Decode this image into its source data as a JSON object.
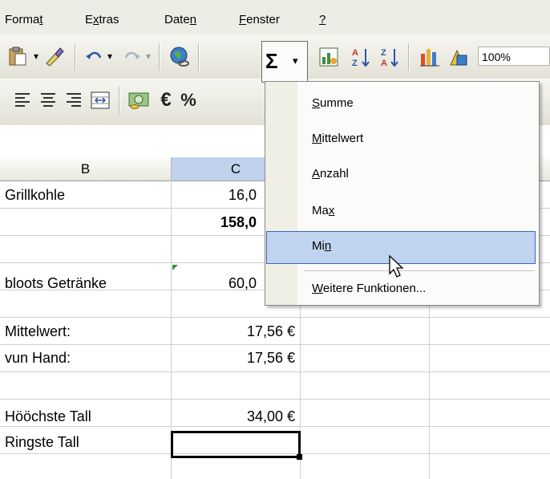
{
  "menubar": {
    "items": [
      {
        "pre": "Forma",
        "u": "t",
        "post": ""
      },
      {
        "pre": "E",
        "u": "x",
        "post": "tras"
      },
      {
        "pre": "Date",
        "u": "n",
        "post": ""
      },
      {
        "pre": "",
        "u": "F",
        "post": "enster"
      },
      {
        "pre": "",
        "u": "?",
        "post": ""
      }
    ]
  },
  "toolbar1": {
    "zoom": "100%",
    "icons": [
      "paste-icon",
      "format-painter-icon",
      "undo-icon",
      "redo-icon",
      "hyperlink-icon",
      "autosum-icon",
      "chart-wizard-icon",
      "sort-ascending-icon",
      "sort-descending-icon",
      "bar-chart-icon",
      "drawing-icon"
    ]
  },
  "toolbar2": {
    "icons": [
      "align-left-icon",
      "align-center-icon",
      "align-right-icon",
      "merge-center-icon",
      "currency-icon",
      "euro-icon"
    ]
  },
  "columns": [
    "B",
    "C"
  ],
  "rows": [
    {
      "b": "Grillkohle",
      "c": "16,0",
      "bold": false
    },
    {
      "b": "",
      "c": "158,0",
      "bold": true
    },
    {
      "b": "",
      "c": "",
      "bold": false
    },
    {
      "b": "bloots Getränke",
      "c": "60,0",
      "bold": false
    },
    {
      "b": "",
      "c": "",
      "bold": false
    },
    {
      "b": "Mittelwert:",
      "c": "17,56 €",
      "bold": false
    },
    {
      "b": "vun Hand:",
      "c": "17,56 €",
      "bold": false
    },
    {
      "b": "",
      "c": "",
      "bold": false
    },
    {
      "b": "Hööchste Tall",
      "c": "34,00 €",
      "bold": false
    },
    {
      "b": "Ringste Tall",
      "c": "",
      "bold": false
    }
  ],
  "dropdown": {
    "items": [
      {
        "pre": "",
        "u": "S",
        "post": "umme"
      },
      {
        "pre": "",
        "u": "M",
        "post": "ittelwert"
      },
      {
        "pre": "",
        "u": "A",
        "post": "nzahl"
      },
      {
        "pre": "Ma",
        "u": "x",
        "post": ""
      },
      {
        "pre": "Mi",
        "u": "n",
        "post": ""
      },
      {
        "pre": "",
        "u": "W",
        "post": "eitere Funktionen..."
      }
    ],
    "highlighted": "Min"
  },
  "colors": {
    "menu_bg": "#eeede5",
    "highlight": "#c0d3ef",
    "selected_col": "#c1d2ee"
  }
}
